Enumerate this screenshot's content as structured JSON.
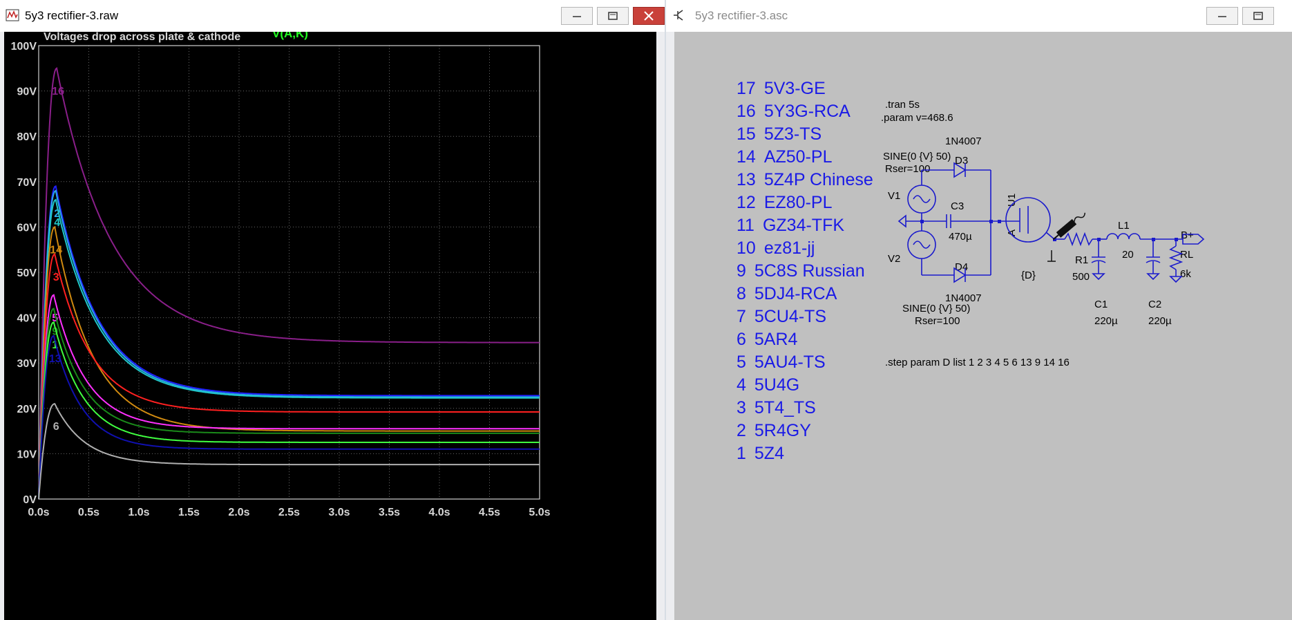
{
  "left_window": {
    "title": "5y3 rectifier-3.raw",
    "plot_title": "Voltages drop across plate & cathode",
    "trace_label": "V(A,K)"
  },
  "right_window": {
    "title": "5y3 rectifier-3.asc",
    "tube_list": [
      {
        "num": "17",
        "name": "5V3-GE"
      },
      {
        "num": "16",
        "name": "5Y3G-RCA"
      },
      {
        "num": "15",
        "name": "5Z3-TS"
      },
      {
        "num": "14",
        "name": "AZ50-PL"
      },
      {
        "num": "13",
        "name": "5Z4P Chinese"
      },
      {
        "num": "12",
        "name": "EZ80-PL"
      },
      {
        "num": "11",
        "name": "GZ34-TFK"
      },
      {
        "num": "10",
        "name": "ez81-jj"
      },
      {
        "num": "9",
        "name": "5C8S Russian"
      },
      {
        "num": "8",
        "name": "5DJ4-RCA"
      },
      {
        "num": "7",
        "name": "5CU4-TS"
      },
      {
        "num": "6",
        "name": "5AR4"
      },
      {
        "num": "5",
        "name": "5AU4-TS"
      },
      {
        "num": "4",
        "name": "5U4G"
      },
      {
        "num": "3",
        "name": "5T4_TS"
      },
      {
        "num": "2",
        "name": "5R4GY"
      },
      {
        "num": "1",
        "name": "5Z4"
      }
    ],
    "directives": {
      "tran": ".tran 5s",
      "param": ".param v=468.6",
      "step": ".step param D list 1 2 3 4 5 6 13 9 14 16"
    },
    "components": {
      "d3_model": "1N4007",
      "d3_name": "D3",
      "d4_model": "1N4007",
      "d4_name": "D4",
      "v1_func": "SINE(0 {V} 50)",
      "v1_rser": "Rser=100",
      "v1_name": "V1",
      "v2_func": "SINE(0 {V} 50)",
      "v2_rser": "Rser=100",
      "v2_name": "V2",
      "c3_name": "C3",
      "c3_value": "470µ",
      "u1_name": "U1",
      "node_a": "A",
      "u1_value": "{D}",
      "r1_name": "R1",
      "r1_value": "500",
      "l1_name": "L1",
      "l1_value": "20",
      "c1_name": "C1",
      "c1_value": "220µ",
      "c2_name": "C2",
      "c2_value": "220µ",
      "rl_name": "RL",
      "rl_value": "6k",
      "net_label": "B+"
    }
  },
  "chart_data": {
    "type": "line",
    "title": "Voltages drop across plate & cathode",
    "xlabel": "",
    "ylabel": "",
    "xlim": [
      0,
      5
    ],
    "ylim": [
      0,
      100
    ],
    "x_ticks": [
      "0.0s",
      "0.5s",
      "1.0s",
      "1.5s",
      "2.0s",
      "2.5s",
      "3.0s",
      "3.5s",
      "4.0s",
      "4.5s",
      "5.0s"
    ],
    "y_ticks": [
      "0V",
      "10V",
      "20V",
      "30V",
      "40V",
      "50V",
      "60V",
      "70V",
      "80V",
      "90V",
      "100V"
    ],
    "grid": true,
    "legend": "top-center",
    "series": [
      {
        "name": "16",
        "color": "#8a1f8a",
        "peak": 95,
        "peak_t": 0.18,
        "final": 34.5,
        "tau": 0.55
      },
      {
        "name": "",
        "color": "#2020ff",
        "peak": 69,
        "peak_t": 0.17,
        "final": 22.8,
        "tau": 0.42
      },
      {
        "name": "2",
        "color": "#2aa8e8",
        "peak": 68,
        "peak_t": 0.17,
        "final": 22.5,
        "tau": 0.42
      },
      {
        "name": "4",
        "color": "#20c8c8",
        "peak": 66,
        "peak_t": 0.17,
        "final": 22.3,
        "tau": 0.42
      },
      {
        "name": "14",
        "color": "#d08a10",
        "peak": 60,
        "peak_t": 0.16,
        "final": 15.0,
        "tau": 0.38
      },
      {
        "name": "3",
        "color": "#ff2020",
        "peak": 54,
        "peak_t": 0.16,
        "final": 19.2,
        "tau": 0.36
      },
      {
        "name": "5",
        "color": "#ff30ff",
        "peak": 45,
        "peak_t": 0.15,
        "final": 15.5,
        "tau": 0.32
      },
      {
        "name": "9",
        "color": "#1a8a1a",
        "peak": 42,
        "peak_t": 0.15,
        "final": 14.5,
        "tau": 0.3
      },
      {
        "name": "1",
        "color": "#40ff40",
        "peak": 39,
        "peak_t": 0.15,
        "final": 12.5,
        "tau": 0.3
      },
      {
        "name": "13",
        "color": "#1010b0",
        "peak": 36,
        "peak_t": 0.15,
        "final": 11.0,
        "tau": 0.28
      },
      {
        "name": "6",
        "color": "#b0b0b0",
        "peak": 21,
        "peak_t": 0.16,
        "final": 7.6,
        "tau": 0.3
      }
    ]
  }
}
